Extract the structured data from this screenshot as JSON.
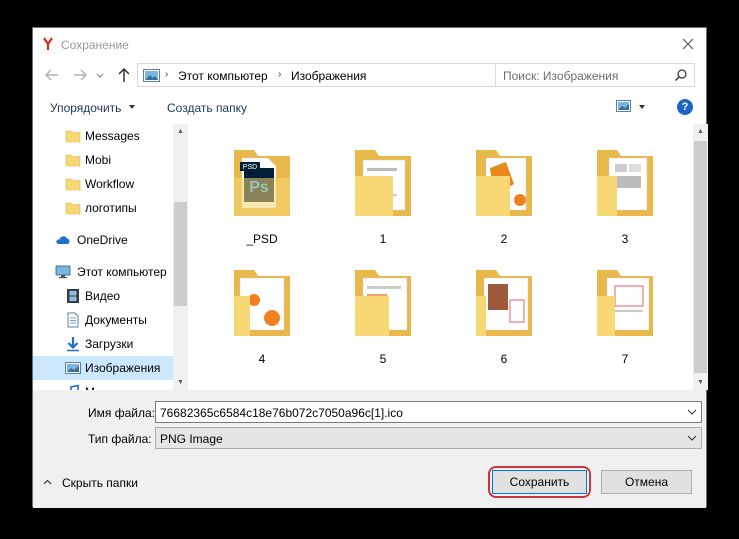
{
  "window": {
    "title": "Сохранение",
    "app_icon": "yandex-icon"
  },
  "address": {
    "breadcrumbs": [
      "Этот компьютер",
      "Изображения"
    ],
    "search_placeholder": "Поиск: Изображения"
  },
  "toolbar": {
    "organize_label": "Упорядочить",
    "new_folder_label": "Создать папку",
    "help_label": "?"
  },
  "nav": {
    "items": [
      {
        "label": "Messages",
        "icon": "folder-icon"
      },
      {
        "label": "Mobi",
        "icon": "folder-icon"
      },
      {
        "label": "Workflow",
        "icon": "folder-icon"
      },
      {
        "label": "логотипы",
        "icon": "folder-icon"
      },
      {
        "label": "OneDrive",
        "icon": "cloud-icon"
      },
      {
        "label": "Этот компьютер",
        "icon": "computer-icon"
      },
      {
        "label": "Видео",
        "icon": "video-icon"
      },
      {
        "label": "Документы",
        "icon": "documents-icon"
      },
      {
        "label": "Загрузки",
        "icon": "downloads-icon"
      },
      {
        "label": "Изображения",
        "icon": "pictures-icon",
        "selected": true
      },
      {
        "label": "М",
        "icon": "music-icon"
      }
    ]
  },
  "folders": [
    {
      "name": "_PSD"
    },
    {
      "name": "1"
    },
    {
      "name": "2"
    },
    {
      "name": "3"
    },
    {
      "name": "4"
    },
    {
      "name": "5"
    },
    {
      "name": "6"
    },
    {
      "name": "7"
    },
    {
      "name": ""
    },
    {
      "name": ""
    },
    {
      "name": ""
    },
    {
      "name": ""
    }
  ],
  "form": {
    "filename_label": "Имя файла:",
    "filename_value": "76682365c6584c18e76b072c7050a96c[1].ico",
    "filetype_label": "Тип файла:",
    "filetype_value": "PNG Image",
    "hide_folders_label": "Скрыть папки",
    "save_label": "Сохранить",
    "cancel_label": "Отмена"
  },
  "colors": {
    "folder": "#f8d775",
    "selection": "#cce8ff",
    "accent": "#0078d7",
    "highlight_ring": "#c9353a",
    "help": "#1b65c4"
  }
}
